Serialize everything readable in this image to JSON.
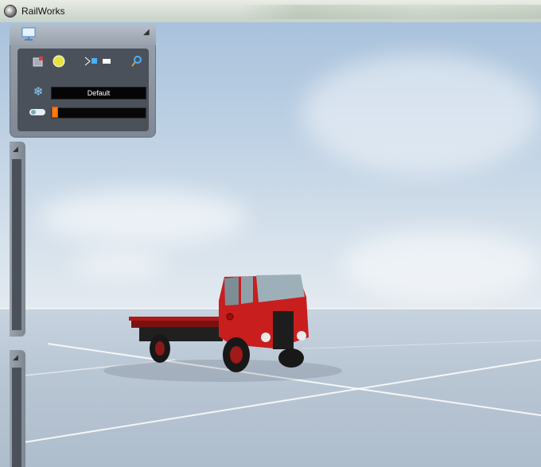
{
  "window": {
    "title": "RailWorks"
  },
  "panel": {
    "tools": [
      "paint-icon",
      "sun-icon",
      "route-icon",
      "signal-icon",
      "search-icon"
    ],
    "weather_label": "Default",
    "time_slider_value": 0.0
  },
  "scene": {
    "vehicle": "red flatbed lorry"
  },
  "colors": {
    "accent": "#ff7a10",
    "vehicle": "#c81e1e"
  }
}
